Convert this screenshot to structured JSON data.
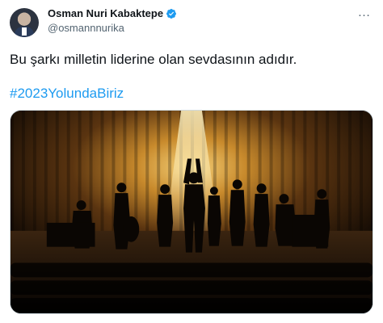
{
  "tweet": {
    "author": {
      "display_name": "Osman Nuri Kabaktepe",
      "handle": "@osmannnurika",
      "verified": true
    },
    "text": "Bu şarkı milletin liderine olan sevdasının adıdır.",
    "hashtag": "#2023YolundaBiriz",
    "more_icon": "…"
  },
  "colors": {
    "text": "#0f1419",
    "secondary": "#536471",
    "link": "#1d9bf0",
    "verified": "#1d9bf0"
  },
  "icons": {
    "verified": "verified-badge-icon",
    "more": "more-options-icon"
  }
}
